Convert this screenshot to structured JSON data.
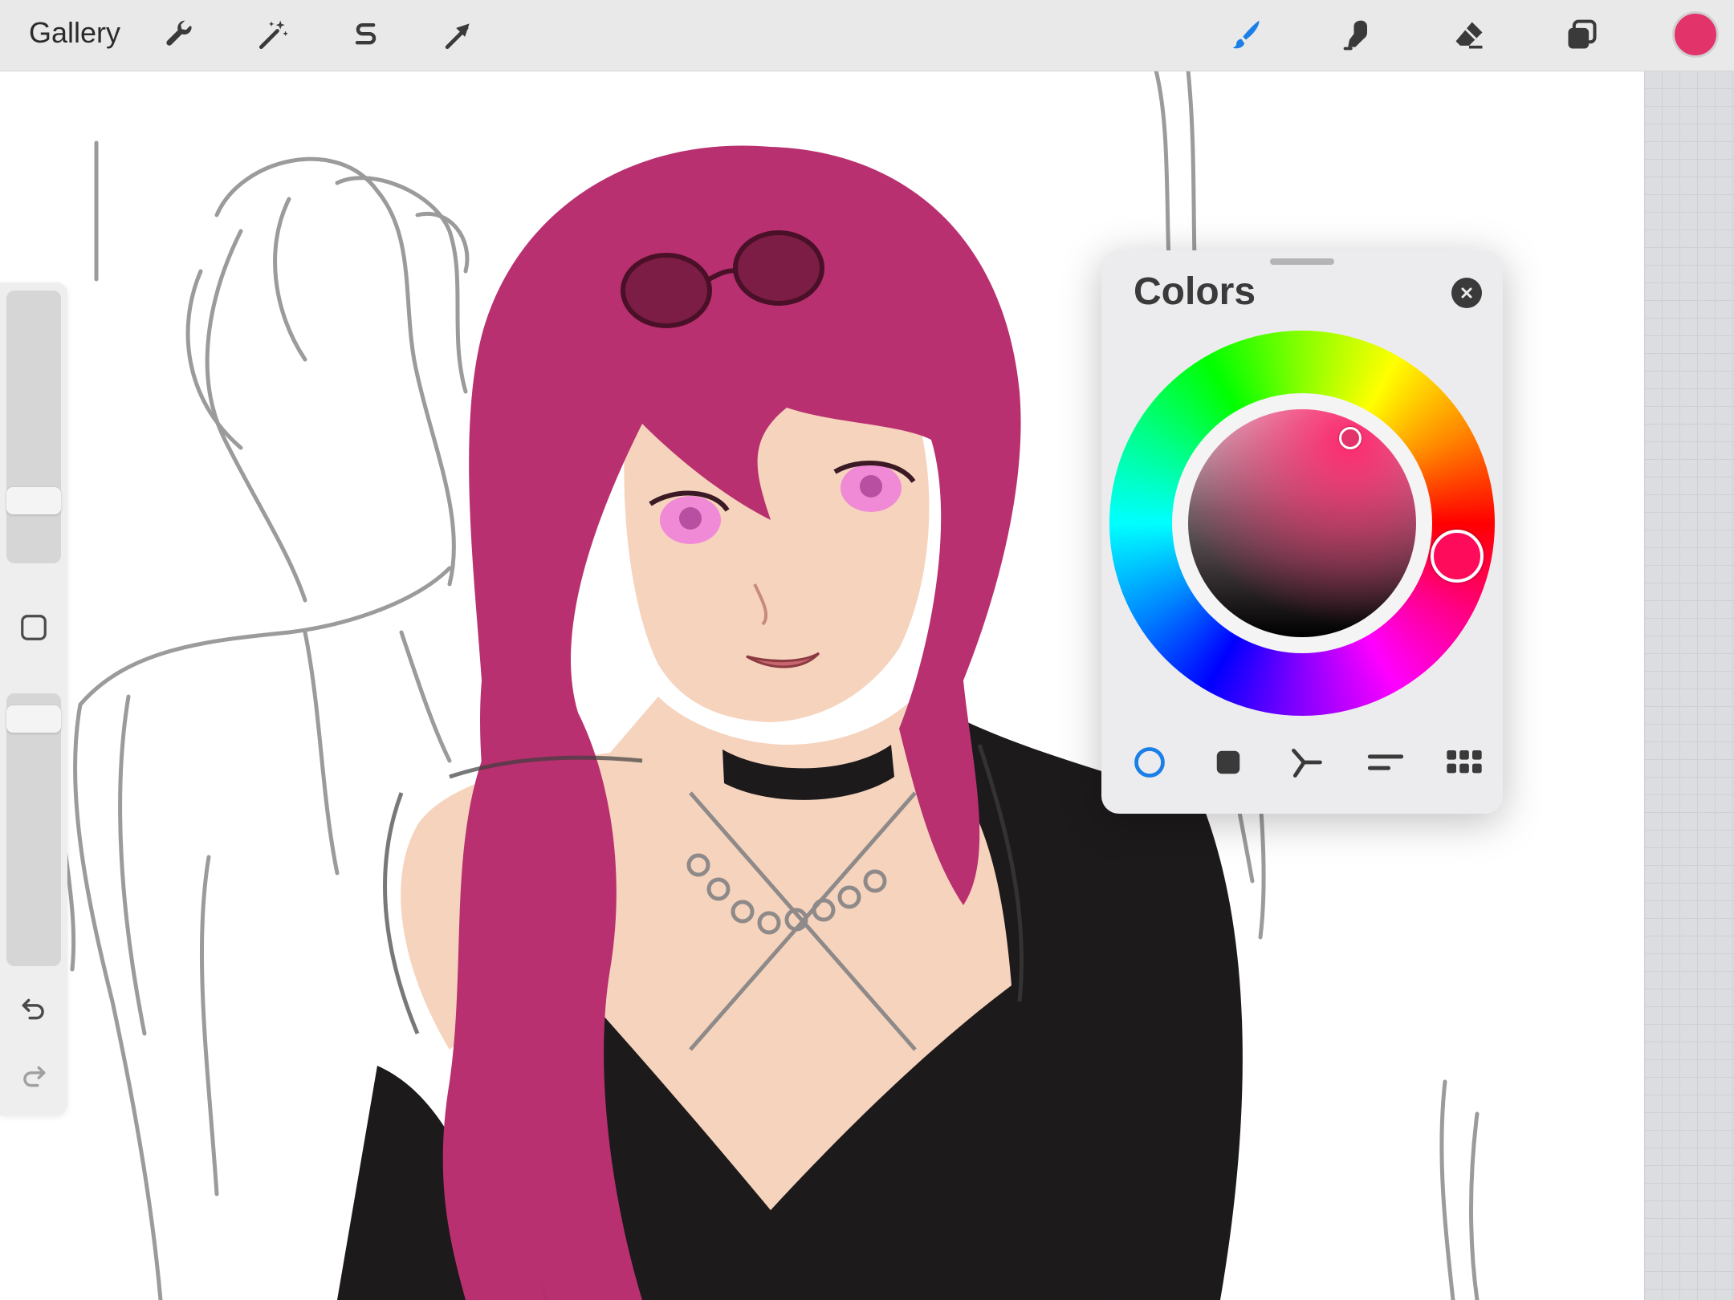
{
  "toolbar": {
    "gallery_label": "Gallery",
    "left_tools": [
      {
        "name": "actions-wrench",
        "icon": "wrench-icon"
      },
      {
        "name": "adjustments",
        "icon": "magic-wand-icon"
      },
      {
        "name": "selection",
        "icon": "selection-s-icon"
      },
      {
        "name": "transform",
        "icon": "arrow-cursor-icon"
      }
    ],
    "right_tools": [
      {
        "name": "brush",
        "icon": "brush-icon",
        "active": true
      },
      {
        "name": "smudge",
        "icon": "smudge-finger-icon",
        "active": false
      },
      {
        "name": "eraser",
        "icon": "eraser-icon",
        "active": false
      },
      {
        "name": "layers",
        "icon": "layers-icon",
        "active": false
      }
    ],
    "current_color": "#e3336b",
    "active_tool_color": "#1a7fe6"
  },
  "sidebar": {
    "size_slider_level": 0.8,
    "opacity_slider_level": 0.95,
    "modify_icon": "square-outline-icon",
    "undo_icon": "undo-arrow-icon",
    "redo_icon": "redo-arrow-icon"
  },
  "colors_panel": {
    "title": "Colors",
    "close_icon": "close-x-icon",
    "selected_hue_color": "#ff0b5c",
    "selected_color": "#e3336b",
    "mode_tabs": [
      {
        "name": "disc",
        "icon": "circle-ring-icon",
        "active": true
      },
      {
        "name": "classic",
        "icon": "filled-square-icon",
        "active": false
      },
      {
        "name": "harmony",
        "icon": "harmony-branch-icon",
        "active": false
      },
      {
        "name": "value",
        "icon": "sliders-lines-icon",
        "active": false
      },
      {
        "name": "palettes",
        "icon": "grid-dots-icon",
        "active": false
      }
    ]
  },
  "canvas": {
    "hair_color": "#b8306f",
    "skin_color": "#f6d3bd",
    "dress_color": "#1d1a1c",
    "sketch_color": "#8a8a8a"
  }
}
